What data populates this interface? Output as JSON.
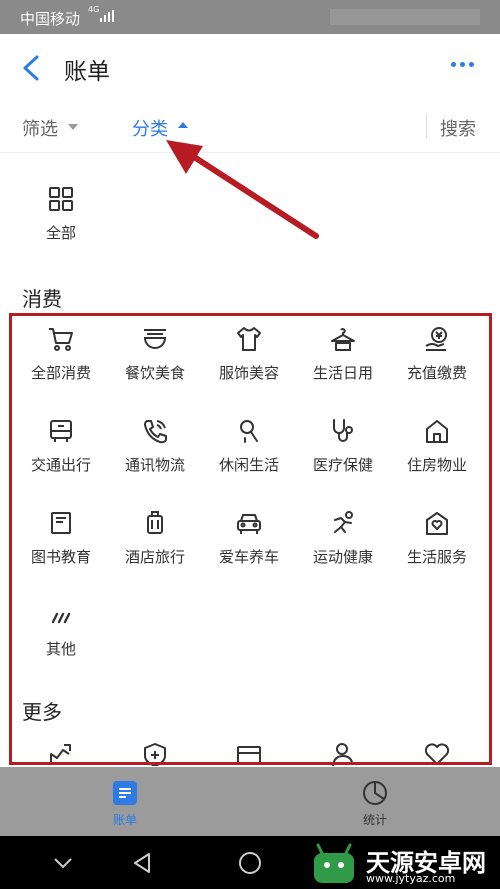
{
  "status_bar": {
    "carrier": "中国移动",
    "network": "4G"
  },
  "header": {
    "title": "账单"
  },
  "filter_bar": {
    "screen_label": "筛选",
    "category_label": "分类",
    "search_label": "搜索"
  },
  "all_category": {
    "label": "全部",
    "icon": "grid-icon"
  },
  "consumption": {
    "heading": "消费",
    "items": [
      {
        "label": "全部消费",
        "icon": "cart-icon"
      },
      {
        "label": "餐饮美食",
        "icon": "bowl-icon"
      },
      {
        "label": "服饰美容",
        "icon": "shirt-icon"
      },
      {
        "label": "生活日用",
        "icon": "hanger-icon"
      },
      {
        "label": "充值缴费",
        "icon": "coin-hand-icon"
      },
      {
        "label": "交通出行",
        "icon": "bus-icon"
      },
      {
        "label": "通讯物流",
        "icon": "phone-icon"
      },
      {
        "label": "休闲生活",
        "icon": "leisure-icon"
      },
      {
        "label": "医疗保健",
        "icon": "stethoscope-icon"
      },
      {
        "label": "住房物业",
        "icon": "house-icon"
      },
      {
        "label": "图书教育",
        "icon": "book-icon"
      },
      {
        "label": "酒店旅行",
        "icon": "luggage-icon"
      },
      {
        "label": "爱车养车",
        "icon": "car-icon"
      },
      {
        "label": "运动健康",
        "icon": "runner-icon"
      },
      {
        "label": "生活服务",
        "icon": "home-heart-icon"
      },
      {
        "label": "其他",
        "icon": "other-icon"
      }
    ]
  },
  "more": {
    "heading": "更多",
    "icons": [
      "investment-icon",
      "shield-plus-icon",
      "card-icon",
      "person-icon",
      "heart-icon"
    ]
  },
  "tab_bar": {
    "tabs": [
      {
        "label": "账单",
        "icon": "bill-icon",
        "active": true
      },
      {
        "label": "统计",
        "icon": "pie-chart-icon",
        "active": false
      }
    ]
  },
  "watermark": {
    "name": "天源安卓网",
    "url": "www.jytyaz.com"
  },
  "colors": {
    "accent": "#2e7ae6",
    "annotation": "#b71c24"
  }
}
